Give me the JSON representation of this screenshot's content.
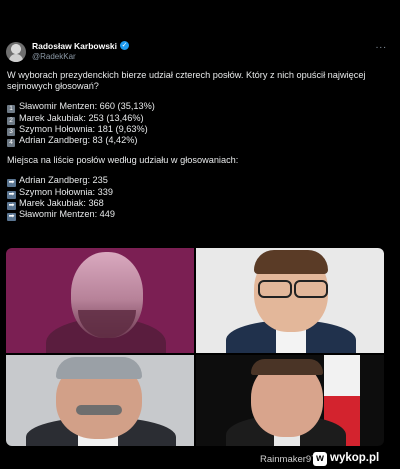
{
  "tweet": {
    "author_name": "Radosław Karbowski",
    "author_handle": "@RadekKar",
    "more_icon": "...",
    "text_intro": "W wyborach prezydenckich bierze udział czterech posłów. Który z nich opuścił najwięcej sejmowych głosowań?",
    "ranking": [
      {
        "badge": "1",
        "text": "Sławomir Mentzen: 660 (35,13%)"
      },
      {
        "badge": "2",
        "text": "Marek Jakubiak: 253 (13,46%)"
      },
      {
        "badge": "3",
        "text": "Szymon Hołownia: 181 (9,63%)"
      },
      {
        "badge": "4",
        "text": "Adrian Zandberg: 83 (4,42%)"
      }
    ],
    "list_heading": "Miejsca na liście posłów według udziału w głosowaniach:",
    "places": [
      {
        "text": "Adrian Zandberg: 235"
      },
      {
        "text": "Szymon Hołownia: 339"
      },
      {
        "text": "Marek Jakubiak: 368"
      },
      {
        "text": "Sławomir Mentzen: 449"
      }
    ],
    "arrow_symbol": "➡"
  },
  "footer": {
    "text": "Rainmaker97  z",
    "logo_icon": "w",
    "logo_text": "wykop.pl"
  },
  "colors": {
    "verified": "#1d9bf0",
    "photo_1_bg": "#7b1f53"
  },
  "icons": {
    "verified": "verified-badge-icon",
    "more": "more-options-icon",
    "arrow": "right-arrow-icon"
  }
}
